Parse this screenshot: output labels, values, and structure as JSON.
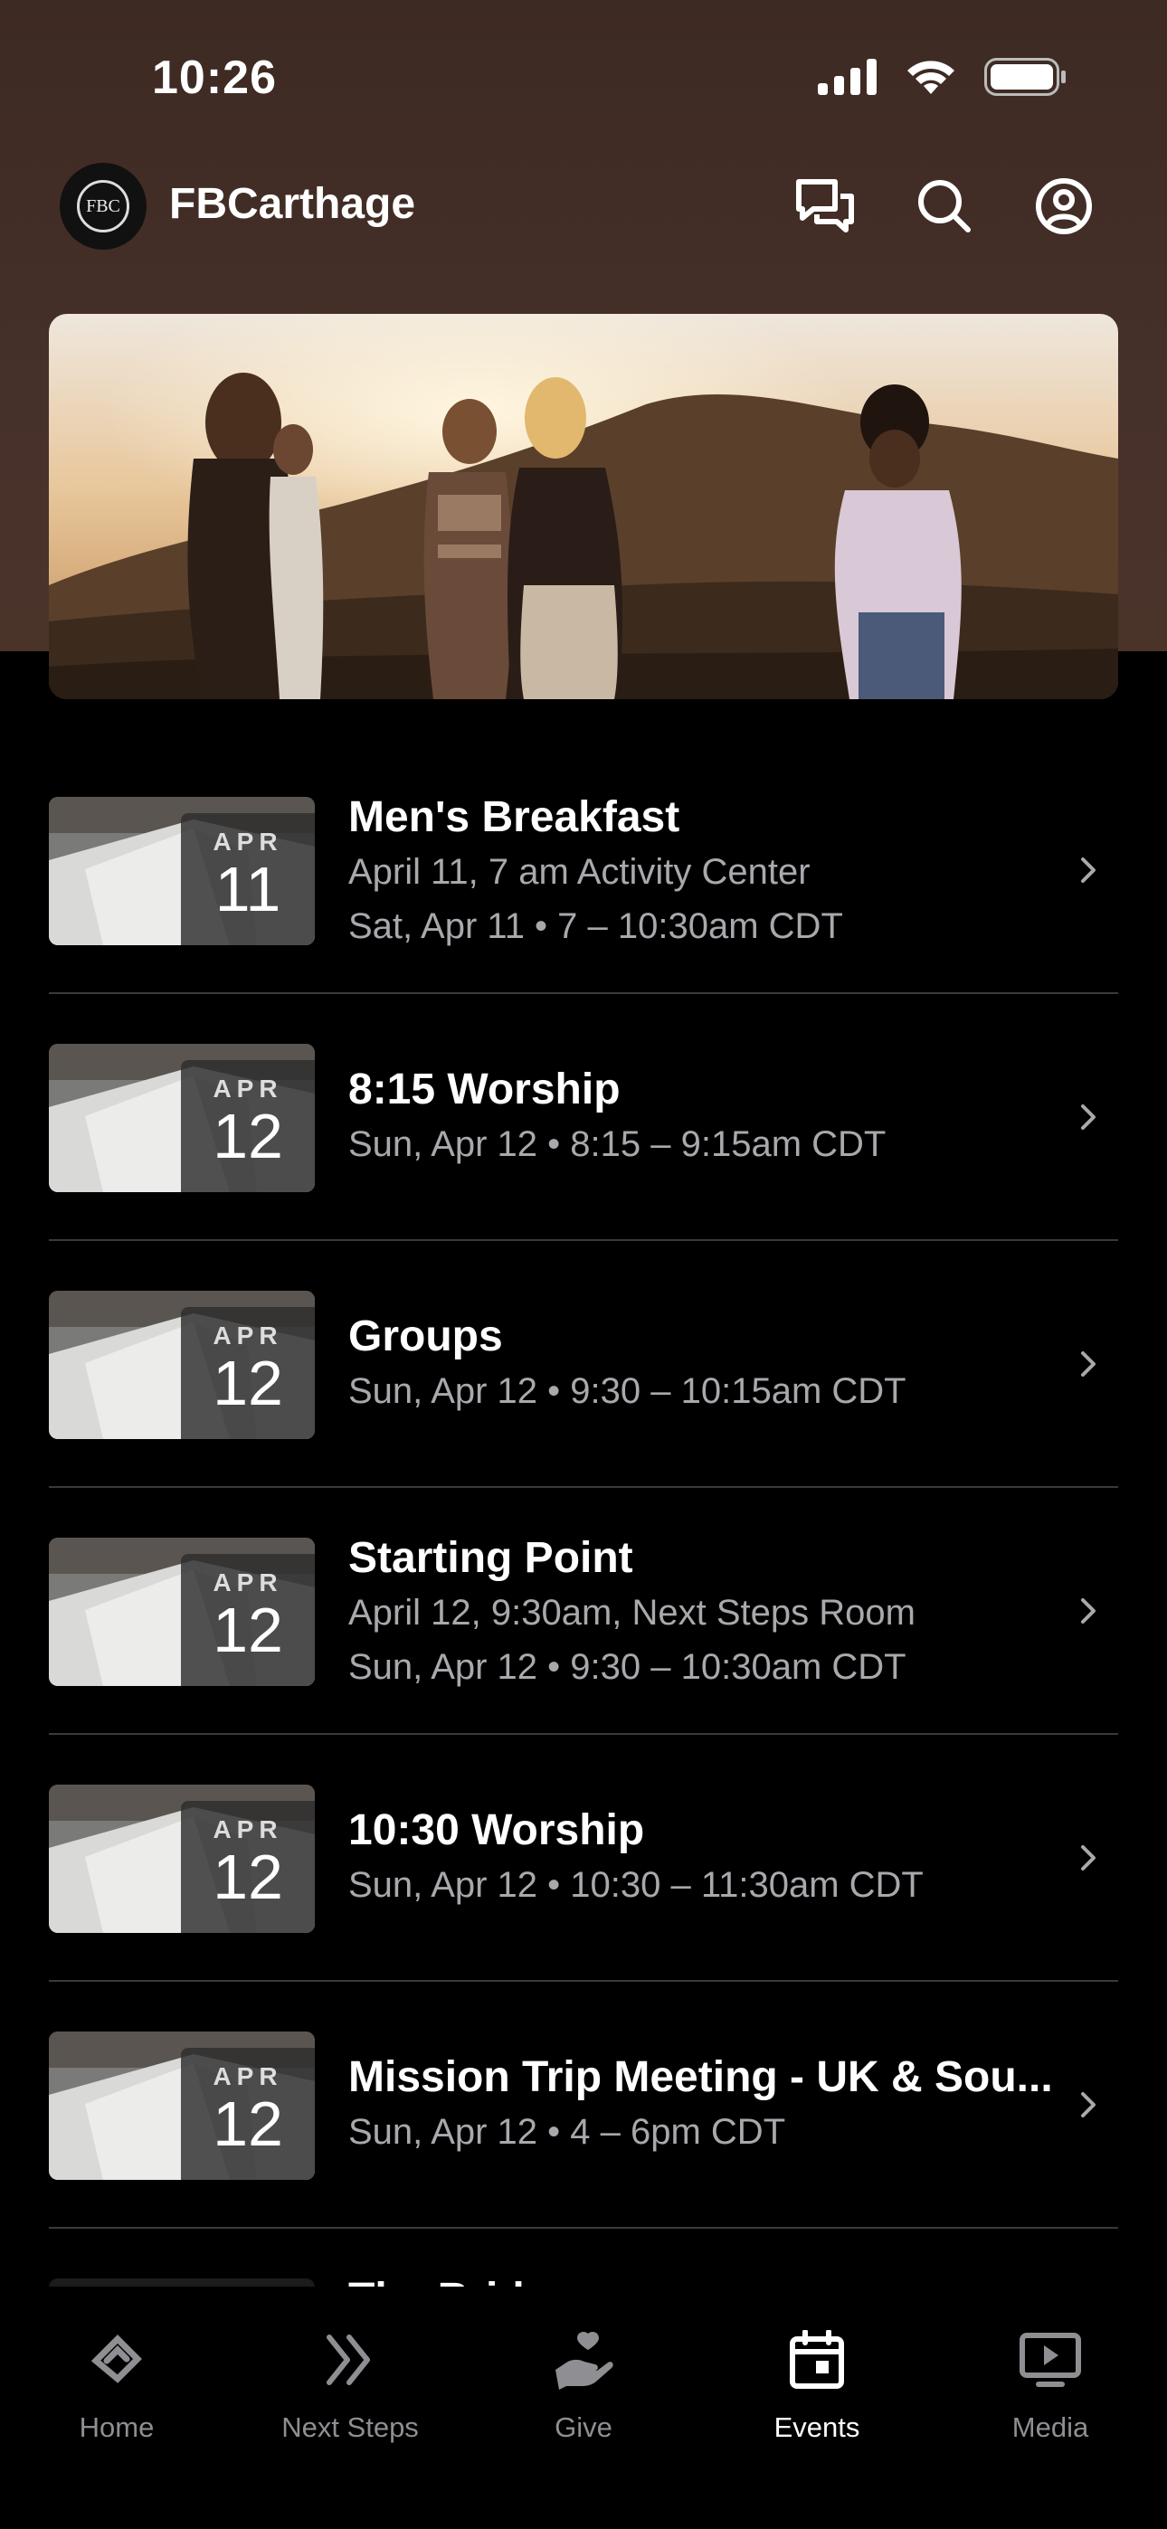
{
  "status_bar": {
    "time": "10:26"
  },
  "app": {
    "title": "FBCarthage",
    "logo_text": "FBC"
  },
  "header_icons": [
    "messages-icon",
    "search-icon",
    "profile-icon"
  ],
  "events": [
    {
      "month": "APR",
      "day": "11",
      "title": "Men's Breakfast",
      "lines": [
        "April 11, 7 am Activity Center",
        "Sat, Apr 11 • 7 – 10:30am CDT"
      ]
    },
    {
      "month": "APR",
      "day": "12",
      "title": "8:15 Worship",
      "lines": [
        "Sun, Apr 12 • 8:15 – 9:15am CDT"
      ]
    },
    {
      "month": "APR",
      "day": "12",
      "title": "Groups",
      "lines": [
        "Sun, Apr 12 • 9:30 – 10:15am CDT"
      ]
    },
    {
      "month": "APR",
      "day": "12",
      "title": "Starting Point",
      "lines": [
        "April 12, 9:30am, Next Steps Room",
        "Sun, Apr 12 • 9:30 – 10:30am CDT"
      ]
    },
    {
      "month": "APR",
      "day": "12",
      "title": "10:30 Worship",
      "lines": [
        "Sun, Apr 12 • 10:30 – 11:30am CDT"
      ]
    },
    {
      "month": "APR",
      "day": "12",
      "title": "Mission Trip Meeting - UK & Sou...",
      "lines": [
        "Sun, Apr 12 • 4 – 6pm CDT"
      ]
    },
    {
      "month": "",
      "day": "",
      "title": "The Bridge",
      "lines": []
    }
  ],
  "tabs": [
    {
      "label": "Home",
      "icon": "home-icon",
      "active": false
    },
    {
      "label": "Next Steps",
      "icon": "next-steps-icon",
      "active": false
    },
    {
      "label": "Give",
      "icon": "give-icon",
      "active": false
    },
    {
      "label": "Events",
      "icon": "calendar-icon",
      "active": true
    },
    {
      "label": "Media",
      "icon": "media-icon",
      "active": false
    }
  ],
  "colors": {
    "header_brown": "#46302a",
    "background": "#000000",
    "muted_text": "#a8a8ad",
    "tab_inactive": "#8e8e93"
  }
}
